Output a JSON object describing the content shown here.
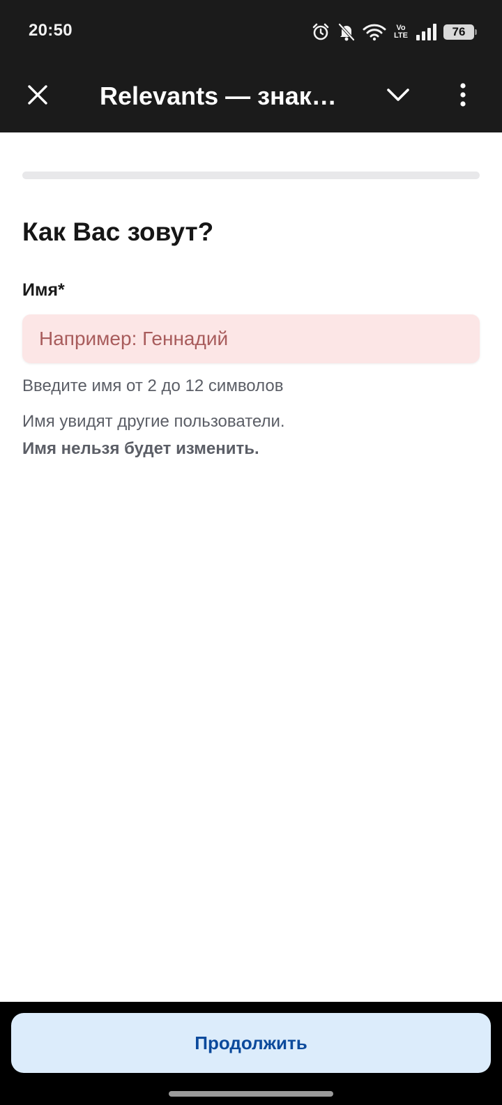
{
  "status_bar": {
    "time": "20:50",
    "network_label": "Vo\nLTE",
    "battery": "76"
  },
  "toolbar": {
    "title": "Relevants — знак…",
    "close_icon": "close-icon",
    "collapse_icon": "chevron-down-icon",
    "menu_icon": "more-vertical-icon"
  },
  "progress": {
    "value": 0.0
  },
  "form": {
    "title": "Как Вас зовут?",
    "name_label": "Имя*",
    "name_value": "",
    "name_placeholder": "Например: Геннадий",
    "hint": "Введите имя от 2 до 12 символов",
    "info": "Имя увидят другие пользователи.",
    "info_bold": "Имя нельзя будет изменить."
  },
  "actions": {
    "continue_label": "Продолжить"
  },
  "colors": {
    "bar_background": "#1b1b1b",
    "input_error_background": "#fce6e6",
    "placeholder_error": "#a85c5c",
    "button_background": "#dcecfb",
    "button_text": "#0c4a9c"
  }
}
